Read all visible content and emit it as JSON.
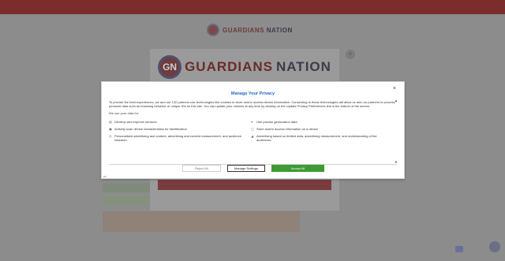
{
  "background": {
    "topbar_text": "",
    "site_logo": {
      "brand_left": "GUARDIANS",
      "brand_right": "NATION"
    },
    "breadcrumb": "",
    "page_heading": "",
    "promo": {
      "logo": {
        "mark": "GN",
        "brand_left": "GUARDIANS",
        "brand_right": "NATION"
      },
      "close": "×",
      "button": "",
      "footer": ""
    },
    "bottom_footer": ""
  },
  "consent": {
    "title": "Manage Your Privacy",
    "close": "×",
    "intro": "To provide the best experiences, we and our 132 partners use technologies like cookies to store and/or access device information. Consenting to these technologies will allow us and our partners to process personal data such as browsing behavior or unique IDs on this site. You can update your choices at any time by clicking on the Update Privacy Preferences link in the bottom of the screen.",
    "usage_title": "We use your data for:",
    "purposes": [
      {
        "icon": "chart-icon",
        "label": "Develop and improve services"
      },
      {
        "icon": "location-pin-icon",
        "label": "Use precise geolocation data"
      },
      {
        "icon": "scan-icon",
        "label": "Actively scan device characteristics for identification"
      },
      {
        "icon": "device-icon",
        "label": "Store and/or access information on a device"
      },
      {
        "icon": "target-icon",
        "label": "Personalised advertising and content, advertising and content measurement, and audience research"
      },
      {
        "icon": "megaphone-icon",
        "label": "Advertising based on limited data, advertising measurement, and understanding of the audiences"
      }
    ],
    "buttons": {
      "reject": "Reject All",
      "manage": "Manage Settings",
      "accept": "Accept All"
    },
    "flag": "▭"
  },
  "colors": {
    "title_blue": "#1f67c8",
    "accept_green": "#3e9a32",
    "brand_red": "#6a2b2b"
  }
}
